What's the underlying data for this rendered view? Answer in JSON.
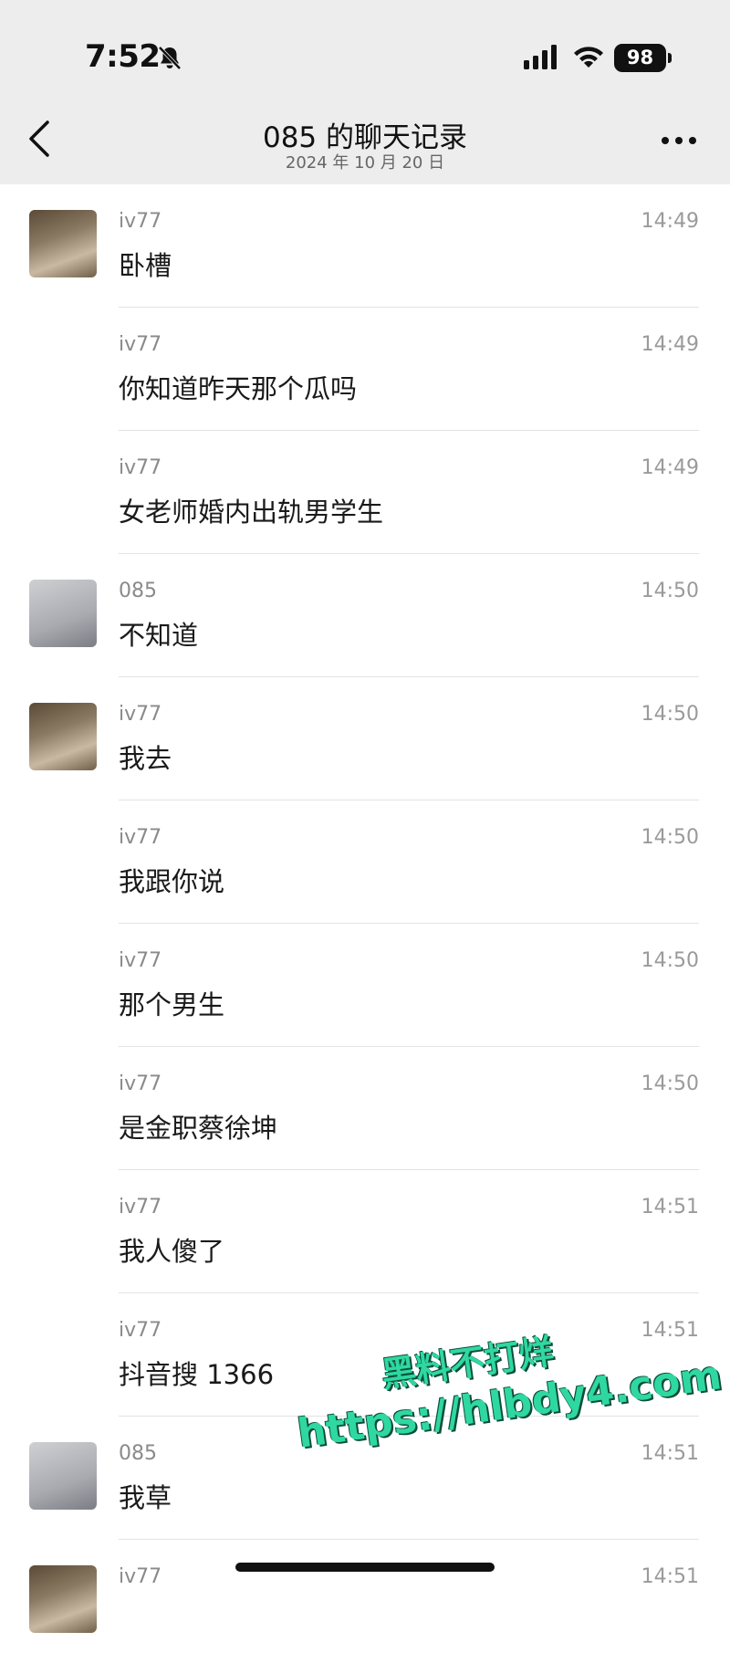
{
  "status_bar": {
    "time": "7:52",
    "battery": "98",
    "bell_icon": "bell-muted-icon",
    "signal_icon": "cellular-signal-icon",
    "wifi_icon": "wifi-icon"
  },
  "header": {
    "title": "085 的聊天记录",
    "subtitle": "2024 年 10 月 20 日",
    "back_icon": "chevron-left-icon",
    "more_icon": "more-dots-icon"
  },
  "messages": [
    {
      "sender": "iv77",
      "text": "卧槽",
      "time": "14:49",
      "avatar": "girl"
    },
    {
      "sender": "iv77",
      "text": "你知道昨天那个瓜吗",
      "time": "14:49",
      "avatar": ""
    },
    {
      "sender": "iv77",
      "text": "女老师婚内出轨男学生",
      "time": "14:49",
      "avatar": ""
    },
    {
      "sender": "085",
      "text": "不知道",
      "time": "14:50",
      "avatar": "dark"
    },
    {
      "sender": "iv77",
      "text": "我去",
      "time": "14:50",
      "avatar": "girl"
    },
    {
      "sender": "iv77",
      "text": "我跟你说",
      "time": "14:50",
      "avatar": ""
    },
    {
      "sender": "iv77",
      "text": "那个男生",
      "time": "14:50",
      "avatar": ""
    },
    {
      "sender": "iv77",
      "text": "是金职蔡徐坤",
      "time": "14:50",
      "avatar": ""
    },
    {
      "sender": "iv77",
      "text": "我人傻了",
      "time": "14:51",
      "avatar": ""
    },
    {
      "sender": "iv77",
      "text": "抖音搜 1366",
      "time": "14:51",
      "avatar": ""
    },
    {
      "sender": "085",
      "text": "我草",
      "time": "14:51",
      "avatar": "dark"
    },
    {
      "sender": "iv77",
      "text": "",
      "time": "14:51",
      "avatar": "girl"
    }
  ],
  "watermark": {
    "line1": "黑料不打烊",
    "line2": "https://hlbdy4.com"
  },
  "colors": {
    "header_bg": "#ededed",
    "watermark": "#2fd8a0"
  }
}
